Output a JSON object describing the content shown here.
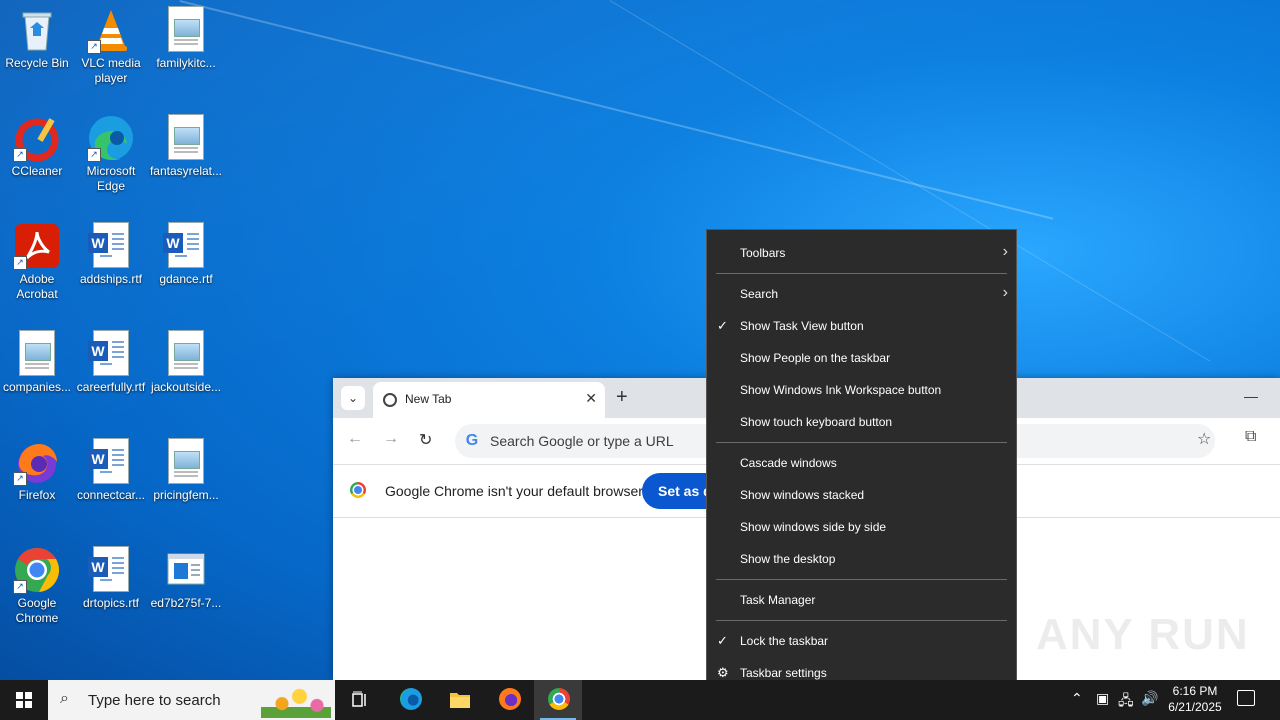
{
  "desktop": {
    "icons": [
      {
        "label": "Recycle Bin",
        "icon": "recycle-bin-icon"
      },
      {
        "label": "VLC media player",
        "icon": "vlc-icon"
      },
      {
        "label": "familykitc...",
        "icon": "image-file-icon"
      },
      {
        "label": "CCleaner",
        "icon": "ccleaner-icon"
      },
      {
        "label": "Microsoft Edge",
        "icon": "edge-icon"
      },
      {
        "label": "fantasyrelat...",
        "icon": "image-file-icon"
      },
      {
        "label": "Adobe Acrobat",
        "icon": "acrobat-icon"
      },
      {
        "label": "addships.rtf",
        "icon": "word-file-icon"
      },
      {
        "label": "gdance.rtf",
        "icon": "word-file-icon"
      },
      {
        "label": "companies...",
        "icon": "image-file-icon"
      },
      {
        "label": "careerfully.rtf",
        "icon": "word-file-icon"
      },
      {
        "label": "jackoutside...",
        "icon": "image-file-icon"
      },
      {
        "label": "Firefox",
        "icon": "firefox-icon"
      },
      {
        "label": "connectcar...",
        "icon": "word-file-icon"
      },
      {
        "label": "pricingfem...",
        "icon": "image-file-icon"
      },
      {
        "label": "Google Chrome",
        "icon": "chrome-icon"
      },
      {
        "label": "drtopics.rtf",
        "icon": "word-file-icon"
      },
      {
        "label": "ed7b275f-7...",
        "icon": "window-file-icon"
      }
    ]
  },
  "chrome": {
    "tab_title": "New Tab",
    "tab_close": "✕",
    "new_tab": "+",
    "minimize": "—",
    "omnibox_placeholder": "Search Google or type a URL",
    "infobar_message": "Google Chrome isn't your default browser",
    "infobar_button": "Set as default"
  },
  "context_menu": {
    "items": [
      {
        "label": "Toolbars",
        "submenu": true
      },
      {
        "label": "Search",
        "submenu": true
      },
      {
        "label": "Show Task View button",
        "checked": true
      },
      {
        "label": "Show People on the taskbar"
      },
      {
        "label": "Show Windows Ink Workspace button"
      },
      {
        "label": "Show touch keyboard button"
      },
      {
        "label": "Cascade windows"
      },
      {
        "label": "Show windows stacked"
      },
      {
        "label": "Show windows side by side"
      },
      {
        "label": "Show the desktop"
      },
      {
        "label": "Task Manager"
      },
      {
        "label": "Lock the taskbar",
        "checked": true
      },
      {
        "label": "Taskbar settings",
        "icon": "gear-icon"
      }
    ]
  },
  "watermark": "ANY RUN",
  "taskbar": {
    "search_placeholder": "Type here to search",
    "time": "6:16 PM",
    "date": "6/21/2025"
  },
  "colors": {
    "accent": "#0b57d0",
    "menu_bg": "#2b2b2b",
    "taskbar_bg": "#1b1b1b"
  }
}
